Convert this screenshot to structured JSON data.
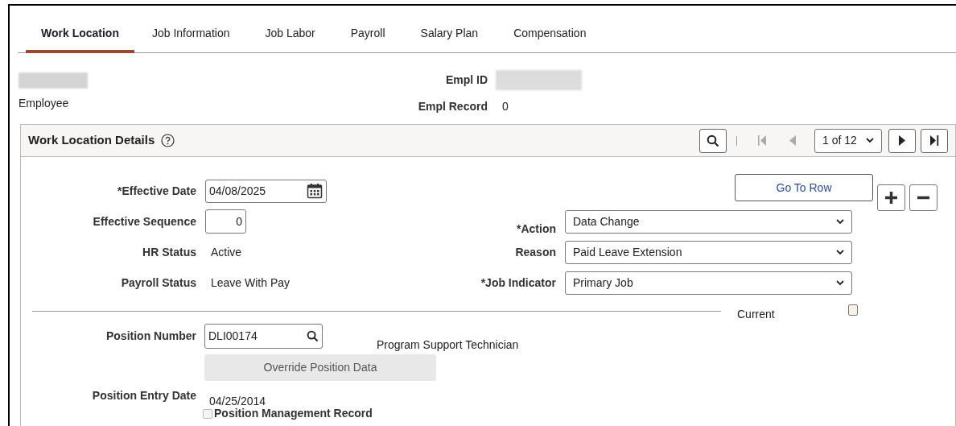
{
  "tabs": [
    {
      "label": "Work Location",
      "selected": true
    },
    {
      "label": "Job Information",
      "selected": false
    },
    {
      "label": "Job Labor",
      "selected": false
    },
    {
      "label": "Payroll",
      "selected": false
    },
    {
      "label": "Salary Plan",
      "selected": false
    },
    {
      "label": "Compensation",
      "selected": false
    }
  ],
  "header": {
    "employee_label": "Employee",
    "empl_id_label": "Empl ID",
    "empl_record_label": "Empl Record",
    "empl_record": "0"
  },
  "panel": {
    "title": "Work Location Details",
    "pager": {
      "value": "1 of 12"
    },
    "go_to_row": "Go To Row"
  },
  "fields_left": [
    {
      "kind": "date",
      "label": "*Effective Date",
      "value": "04/08/2025"
    },
    {
      "kind": "number",
      "label": "Effective Sequence",
      "value": "0"
    },
    {
      "kind": "text",
      "label": "HR Status",
      "value": "Active"
    },
    {
      "kind": "text",
      "label": "Payroll Status",
      "value": "Leave With Pay"
    }
  ],
  "fields_right": [
    {
      "label": "*Action",
      "value": "Data Change"
    },
    {
      "label": "Reason",
      "value": "Paid Leave Extension"
    },
    {
      "label": "*Job Indicator",
      "value": "Primary Job"
    }
  ],
  "current": {
    "label": "Current",
    "checked": false
  },
  "position": {
    "label": "Position Number",
    "value": "DLI00174",
    "title": "Program Support Technician",
    "override_button": {
      "label": "Override Position Data",
      "disabled": true
    },
    "entry_date_label": "Position Entry Date",
    "entry_date": "04/25/2014",
    "management_record": {
      "label": "Position Management Record",
      "checked": false
    }
  }
}
